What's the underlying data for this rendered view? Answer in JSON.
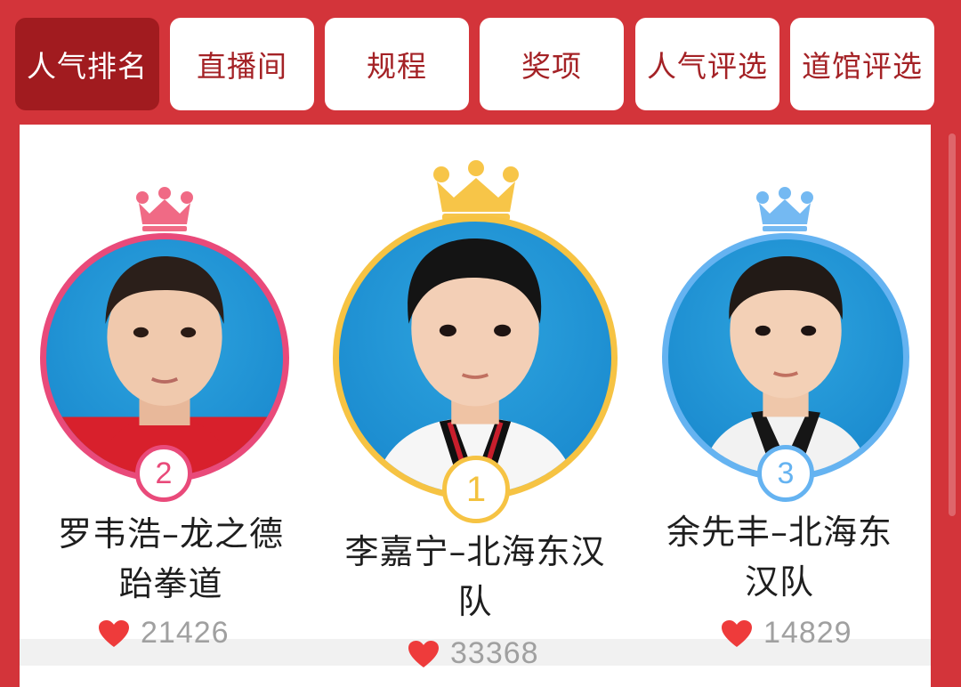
{
  "tabs": [
    {
      "label": "人气排名",
      "active": true
    },
    {
      "label": "直播间",
      "active": false
    },
    {
      "label": "规程",
      "active": false
    },
    {
      "label": "奖项",
      "active": false
    },
    {
      "label": "人气评选",
      "active": false
    },
    {
      "label": "道馆评选",
      "active": false
    }
  ],
  "colors": {
    "background": "#d3343a",
    "active_tab": "#a11b1f",
    "rank1": "#f6c343",
    "rank2": "#e94a7a",
    "rank3": "#65b3f1",
    "heart": "#ee3b3b"
  },
  "ranking": [
    {
      "rank": "2",
      "name_line1": "罗韦浩–龙之德",
      "name_line2": "跆拳道",
      "votes": "21426",
      "crown_icon": "crown-icon"
    },
    {
      "rank": "1",
      "name_line1": "李嘉宁–北海东汉",
      "name_line2": "队",
      "votes": "33368",
      "crown_icon": "crown-icon"
    },
    {
      "rank": "3",
      "name_line1": "余先丰–北海东",
      "name_line2": "汉队",
      "votes": "14829",
      "crown_icon": "crown-icon"
    }
  ]
}
